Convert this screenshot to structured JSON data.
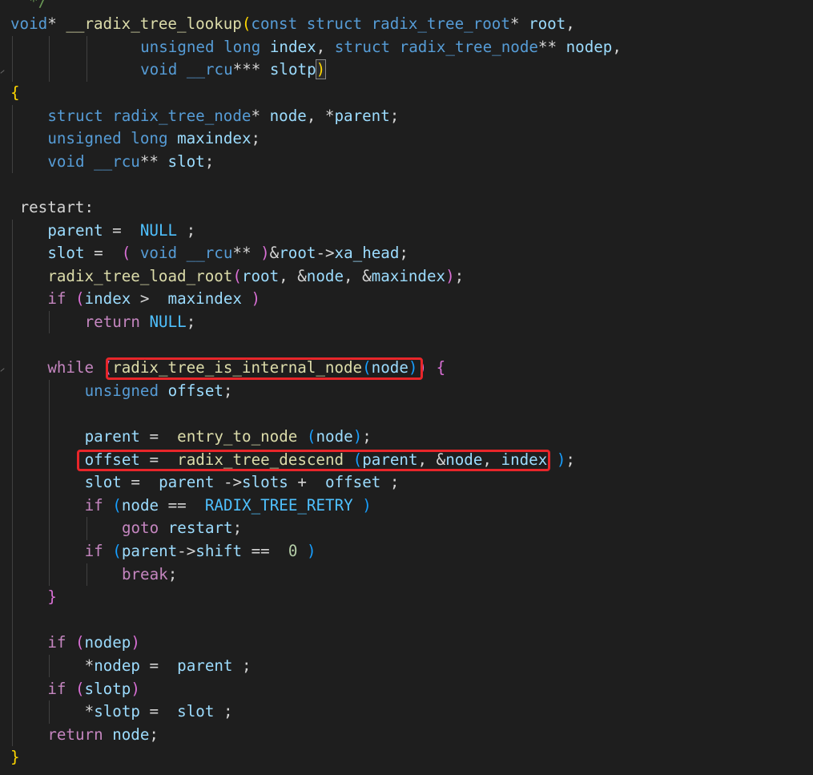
{
  "editor": {
    "language": "c",
    "function_name": "__radix_tree_lookup",
    "theme": {
      "background": "#1e1e1e",
      "keyword": "#569cd6",
      "control": "#c586c0",
      "function": "#dcdcaa",
      "variable": "#9cdcfe",
      "constant": "#4fc1ff",
      "number": "#b5cea8",
      "bracket_level_1": "#ffd700",
      "bracket_level_2": "#da70d6",
      "bracket_level_3": "#179fff",
      "highlight_box": "#e8262a"
    },
    "annotations": [
      {
        "label": "red-box",
        "text": "radix_tree_is_internal_node(node)"
      },
      {
        "label": "red-box",
        "text": "offset = radix_tree_descend(parent, &node, index);"
      }
    ],
    "lines": [
      [
        [
          "cmt",
          "*/"
        ]
      ],
      [
        [
          "kw",
          "void"
        ],
        [
          "",
          "*"
        ],
        [
          "fn",
          "__radix_tree_lookup"
        ],
        [
          "b1",
          "("
        ],
        [
          "kw",
          "const"
        ],
        [
          "",
          ""
        ],
        [
          "kw",
          "struct"
        ],
        [
          "",
          ""
        ],
        [
          "kw",
          "radix_tree_root"
        ],
        [
          "",
          "*"
        ],
        [
          "var",
          "root"
        ],
        [
          "",
          ","
        ]
      ],
      [
        [
          "kw",
          "unsigned"
        ],
        [
          "",
          ""
        ],
        [
          "kw",
          "long"
        ],
        [
          "",
          ""
        ],
        [
          "var",
          "index"
        ],
        [
          "",
          ","
        ],
        [
          "kw",
          "struct"
        ],
        [
          "",
          ""
        ],
        [
          "kw",
          "radix_tree_node"
        ],
        [
          "",
          "**"
        ],
        [
          "var",
          "nodep"
        ],
        [
          "",
          ","
        ]
      ],
      [
        [
          "kw",
          "void"
        ],
        [
          "",
          ""
        ],
        [
          "kw",
          "__rcu"
        ],
        [
          "",
          "***"
        ],
        [
          "var",
          "slotp"
        ],
        [
          "b1",
          ")"
        ]
      ],
      [
        [
          "b1",
          "{"
        ]
      ],
      [
        [
          "kw",
          "struct"
        ],
        [
          "",
          ""
        ],
        [
          "kw",
          "radix_tree_node"
        ],
        [
          "",
          "*"
        ],
        [
          "var",
          "node"
        ],
        [
          "",
          ", *"
        ],
        [
          "var",
          "parent"
        ],
        [
          "",
          ";"
        ]
      ],
      [
        [
          "kw",
          "unsigned"
        ],
        [
          "",
          ""
        ],
        [
          "kw",
          "long"
        ],
        [
          "",
          ""
        ],
        [
          "var",
          "maxindex"
        ],
        [
          "",
          ";"
        ]
      ],
      [
        [
          "kw",
          "void"
        ],
        [
          "",
          ""
        ],
        [
          "kw",
          "__rcu"
        ],
        [
          "",
          "**"
        ],
        [
          "var",
          "slot"
        ],
        [
          "",
          ";"
        ]
      ],
      [],
      [
        [
          "",
          "restart:"
        ]
      ],
      [
        [
          "var",
          "parent"
        ],
        [
          "",
          "="
        ],
        [
          "cst",
          "NULL"
        ],
        [
          "",
          ";"
        ]
      ],
      [
        [
          "var",
          "slot"
        ],
        [
          "",
          "="
        ],
        [
          "b2",
          "("
        ],
        [
          "kw",
          "void"
        ],
        [
          "",
          ""
        ],
        [
          "kw",
          "__rcu"
        ],
        [
          "",
          "**"
        ],
        [
          "b2",
          ")"
        ],
        [
          "",
          "&"
        ],
        [
          "var",
          "root"
        ],
        [
          "",
          "->"
        ],
        [
          "var",
          "xa_head"
        ],
        [
          "",
          ";"
        ]
      ],
      [
        [
          "fn",
          "radix_tree_load_root"
        ],
        [
          "b2",
          "("
        ],
        [
          "var",
          "root"
        ],
        [
          "",
          ", &"
        ],
        [
          "var",
          "node"
        ],
        [
          "",
          ", &"
        ],
        [
          "var",
          "maxindex"
        ],
        [
          "b2",
          ")"
        ],
        [
          "",
          ";"
        ]
      ],
      [
        [
          "ctl",
          "if"
        ],
        [
          "",
          ""
        ],
        [
          "b2",
          "("
        ],
        [
          "var",
          "index"
        ],
        [
          "",
          ">"
        ],
        [
          "var",
          "maxindex"
        ],
        [
          "b2",
          ")"
        ]
      ],
      [
        [
          "ctl",
          "return"
        ],
        [
          "",
          ""
        ],
        [
          "cst",
          "NULL"
        ],
        [
          "",
          ";"
        ]
      ],
      [],
      [
        [
          "ctl",
          "while"
        ],
        [
          "",
          ""
        ],
        [
          "b2",
          "("
        ],
        [
          "fn",
          "radix_tree_is_internal_node"
        ],
        [
          "b3",
          "("
        ],
        [
          "var",
          "node"
        ],
        [
          "b3",
          ")"
        ],
        [
          "b2",
          ")"
        ],
        [
          "",
          ""
        ],
        [
          "b2",
          "{"
        ]
      ],
      [
        [
          "kw",
          "unsigned"
        ],
        [
          "",
          ""
        ],
        [
          "var",
          "offset"
        ],
        [
          "",
          ";"
        ]
      ],
      [],
      [
        [
          "var",
          "parent"
        ],
        [
          "",
          "="
        ],
        [
          "fn",
          "entry_to_node"
        ],
        [
          "b3",
          "("
        ],
        [
          "var",
          "node"
        ],
        [
          "b3",
          ")"
        ],
        [
          "",
          ";"
        ]
      ],
      [
        [
          "var",
          "offset"
        ],
        [
          "",
          "="
        ],
        [
          "fn",
          "radix_tree_descend"
        ],
        [
          "b3",
          "("
        ],
        [
          "var",
          "parent"
        ],
        [
          "",
          ", &"
        ],
        [
          "var",
          "node"
        ],
        [
          "",
          ","
        ],
        [
          "var",
          "index"
        ],
        [
          "b3",
          ")"
        ],
        [
          "",
          ";"
        ]
      ],
      [
        [
          "var",
          "slot"
        ],
        [
          "",
          "="
        ],
        [
          "var",
          "parent"
        ],
        [
          "",
          "->"
        ],
        [
          "var",
          "slots"
        ],
        [
          "",
          "+"
        ],
        [
          "var",
          "offset"
        ],
        [
          "",
          ";"
        ]
      ],
      [
        [
          "ctl",
          "if"
        ],
        [
          "",
          ""
        ],
        [
          "b3",
          "("
        ],
        [
          "var",
          "node"
        ],
        [
          "",
          "=="
        ],
        [
          "cst",
          "RADIX_TREE_RETRY"
        ],
        [
          "b3",
          ")"
        ]
      ],
      [
        [
          "ctl",
          "goto"
        ],
        [
          "",
          ""
        ],
        [
          "var",
          "restart"
        ],
        [
          "",
          ";"
        ]
      ],
      [
        [
          "ctl",
          "if"
        ],
        [
          "",
          ""
        ],
        [
          "b3",
          "("
        ],
        [
          "var",
          "parent"
        ],
        [
          "",
          "->"
        ],
        [
          "var",
          "shift"
        ],
        [
          "",
          "=="
        ],
        [
          "num",
          "0"
        ],
        [
          "b3",
          ")"
        ]
      ],
      [
        [
          "ctl",
          "break"
        ],
        [
          "",
          ";"
        ]
      ],
      [
        [
          "b2",
          "}"
        ]
      ],
      [],
      [
        [
          "ctl",
          "if"
        ],
        [
          "",
          ""
        ],
        [
          "b2",
          "("
        ],
        [
          "var",
          "nodep"
        ],
        [
          "b2",
          ")"
        ]
      ],
      [
        [
          "",
          "*"
        ],
        [
          "var",
          "nodep"
        ],
        [
          "",
          "="
        ],
        [
          "var",
          "parent"
        ],
        [
          "",
          ";"
        ]
      ],
      [
        [
          "ctl",
          "if"
        ],
        [
          "",
          ""
        ],
        [
          "b2",
          "("
        ],
        [
          "var",
          "slotp"
        ],
        [
          "b2",
          ")"
        ]
      ],
      [
        [
          "",
          "*"
        ],
        [
          "var",
          "slotp"
        ],
        [
          "",
          "="
        ],
        [
          "var",
          "slot"
        ],
        [
          "",
          ";"
        ]
      ],
      [
        [
          "ctl",
          "return"
        ],
        [
          "",
          ""
        ],
        [
          "var",
          "node"
        ],
        [
          "",
          ";"
        ]
      ],
      [
        [
          "b1",
          "}"
        ]
      ]
    ]
  }
}
